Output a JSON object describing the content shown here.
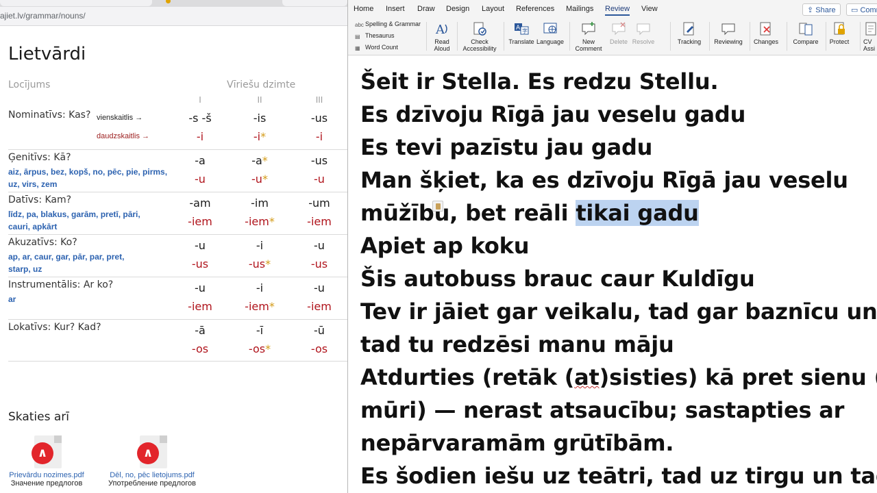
{
  "browser": {
    "url": "ajiet.lv/grammar/nouns/",
    "page_title": "Lietvārdi",
    "table": {
      "case_header": "Locījums",
      "gender_header": "Vīriešu dzimte",
      "columns": [
        "I",
        "II",
        "III"
      ],
      "singular_label": "vienskaitlis →",
      "plural_label": "daudzskaitlis →",
      "rows": [
        {
          "case": "Nominatīvs: Kas?",
          "prepositions": [],
          "sg": [
            "-s -š",
            "-is",
            "-us"
          ],
          "pl": [
            "-i",
            "-i",
            "-i"
          ]
        },
        {
          "case": "Ģenitīvs: Kā?",
          "prepositions": [
            "aiz, ārpus, bez, kopš, no, pēc, pie, pirms,",
            "uz, virs, zem"
          ],
          "sg": [
            "-a",
            "-a",
            "-us"
          ],
          "pl": [
            "-u",
            "-u",
            "-u"
          ]
        },
        {
          "case": "Datīvs: Kam?",
          "prepositions": [
            "līdz, pa, blakus, garām, pretī, pāri,",
            "cauri, apkārt"
          ],
          "sg": [
            "-am",
            "-im",
            "-um"
          ],
          "pl": [
            "-iem",
            "-iem",
            "-iem"
          ]
        },
        {
          "case": "Akuzatīvs: Ko?",
          "prepositions": [
            "ap, ar, caur, gar, pār, par, pret,",
            "starp, uz"
          ],
          "sg": [
            "-u",
            "-i",
            "-u"
          ],
          "pl": [
            "-us",
            "-us",
            "-us"
          ]
        },
        {
          "case": "Instrumentālis: Ar ko?",
          "prepositions": [
            "ar"
          ],
          "sg": [
            "-u",
            "-i",
            "-u"
          ],
          "pl": [
            "-iem",
            "-iem",
            "-iem"
          ]
        },
        {
          "case": "Lokatīvs: Kur? Kad?",
          "prepositions": [],
          "sg": [
            "-ā",
            "-ī",
            "-ū"
          ],
          "pl": [
            "-os",
            "-os",
            "-os"
          ]
        }
      ],
      "star_mark": "*"
    },
    "see_also": {
      "title": "Skaties arī",
      "files": [
        {
          "name": "Prievārdu nozimes.pdf",
          "subtitle": "Значение предлогов",
          "icon": "pdf-icon"
        },
        {
          "name": "Dēl, no, pēc lietojums.pdf",
          "subtitle": "Употребление предлогов",
          "icon": "pdf-icon"
        }
      ]
    }
  },
  "word": {
    "tabs": [
      "Home",
      "Insert",
      "Draw",
      "Design",
      "Layout",
      "References",
      "Mailings",
      "Review",
      "View"
    ],
    "active_tab": "Review",
    "share_label": "Share",
    "comments_label": "Comme",
    "proofing": [
      "Spelling & Grammar",
      "Thesaurus",
      "Word Count"
    ],
    "ribbon_buttons": [
      {
        "label1": "Read",
        "label2": "Aloud",
        "icon": "read-aloud-icon"
      },
      {
        "label1": "Check",
        "label2": "Accessibility",
        "icon": "accessibility-icon"
      },
      {
        "label1": "Translate",
        "label2": "",
        "icon": "translate-icon"
      },
      {
        "label1": "Language",
        "label2": "",
        "icon": "language-icon"
      },
      {
        "label1": "New",
        "label2": "Comment",
        "icon": "new-comment-icon"
      },
      {
        "label1": "Delete",
        "label2": "",
        "icon": "delete-comment-icon"
      },
      {
        "label1": "Resolve",
        "label2": "",
        "icon": "resolve-icon"
      },
      {
        "label1": "Tracking",
        "label2": "",
        "icon": "tracking-icon"
      },
      {
        "label1": "Reviewing",
        "label2": "",
        "icon": "reviewing-icon"
      },
      {
        "label1": "Changes",
        "label2": "",
        "icon": "changes-icon"
      },
      {
        "label1": "Compare",
        "label2": "",
        "icon": "compare-icon"
      },
      {
        "label1": "Protect",
        "label2": "",
        "icon": "protect-icon"
      },
      {
        "label1": "CV",
        "label2": "Assi",
        "icon": "cv-icon"
      }
    ],
    "document": {
      "line1": "Šeit ir Stella. Es redzu Stellu.",
      "line2": "Es dzīvoju Rīgā jau veselu gadu",
      "line3": "Es tevi pazīstu jau gadu",
      "line4": "Man šķiet, ka es dzīvoju Rīgā jau veselu",
      "line5_before": "mūžību, bet reāli ",
      "line5_selected": "tikai gadu",
      "line6": "Apiet ap koku",
      "line7": "Šis autobuss brauc caur Kuldīgu",
      "line8": "Tev ir jāiet gar veikalu, tad gar baznīcu un",
      "line9": "tad tu redzēsi manu māju",
      "line10_a": "Atdurties (retāk (",
      "line10_b": "at",
      "line10_c": ")sisties) kā pret sienu (arī",
      "line11": "mūri) — nerast atsaucību; sastapties ar",
      "line12": "nepārvaramām grūtībām.",
      "line13": "Es šodien iešu uz teātri, tad uz tirgu un tad uz"
    }
  }
}
